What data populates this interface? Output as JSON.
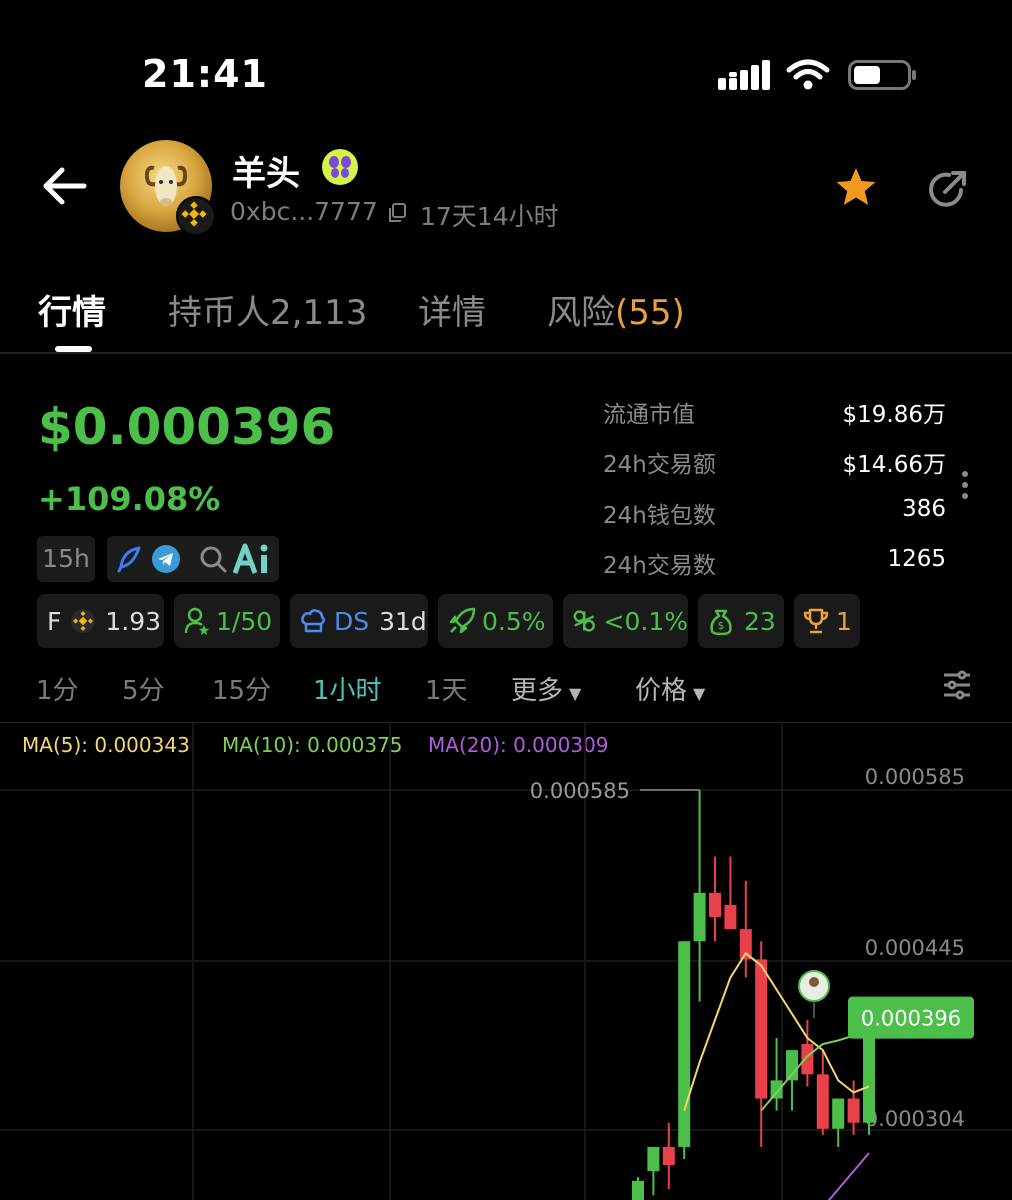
{
  "status_bar": {
    "time": "21:41"
  },
  "header": {
    "token_name": "羊头",
    "address": "0xbc...7777",
    "age": "17天14小时",
    "icons": [
      "back-arrow-icon",
      "ram-avatar-icon",
      "bnb-chain-icon",
      "verified-butterfly-icon",
      "copy-icon",
      "star-icon",
      "share-icon"
    ]
  },
  "tabs": [
    {
      "label": "行情"
    },
    {
      "label": "持币人2,113"
    },
    {
      "label": "详情"
    },
    {
      "label": "风险",
      "count": "(55)"
    }
  ],
  "price": {
    "value": "$0.000396",
    "change": "+109.08%",
    "age_pill": "15h"
  },
  "stats": [
    {
      "label": "流通市值",
      "value": "$19.86万"
    },
    {
      "label": "24h交易额",
      "value": "$14.66万"
    },
    {
      "label": "24h钱包数",
      "value": "386"
    },
    {
      "label": "24h交易数",
      "value": "1265"
    }
  ],
  "badges": {
    "f_label": "F",
    "f_value": "1.93",
    "holders": "1/50",
    "ds_label": "DS",
    "ds_value": "31d",
    "rocket": "0.5%",
    "bundle": "<0.1%",
    "money": "23",
    "trophy": "1"
  },
  "intervals": [
    {
      "label": "1分"
    },
    {
      "label": "5分"
    },
    {
      "label": "15分"
    },
    {
      "label": "1小时",
      "active": true
    },
    {
      "label": "1天"
    },
    {
      "label": "更多"
    },
    {
      "label": "价格"
    }
  ],
  "ma": {
    "ma5": "MA(5): 0.000343",
    "ma10": "MA(10): 0.000375",
    "ma20": "MA(20): 0.000309"
  },
  "chart_data": {
    "type": "candlestick",
    "y_ticks": [
      "0.000585",
      "0.000445",
      "0.000304"
    ],
    "high_label": "0.000585",
    "current_price_label": "0.000396",
    "ylim": [
      0.00024,
      0.00062
    ],
    "candles": [
      {
        "o": 0.000245,
        "h": 0.000265,
        "l": 0.00023,
        "c": 0.000262
      },
      {
        "o": 0.00027,
        "h": 0.00029,
        "l": 0.00025,
        "c": 0.00029
      },
      {
        "o": 0.00029,
        "h": 0.00031,
        "l": 0.000255,
        "c": 0.000275
      },
      {
        "o": 0.00029,
        "h": 0.00046,
        "l": 0.00028,
        "c": 0.00046
      },
      {
        "o": 0.00046,
        "h": 0.000585,
        "l": 0.00041,
        "c": 0.0005
      },
      {
        "o": 0.0005,
        "h": 0.00053,
        "l": 0.00046,
        "c": 0.00048
      },
      {
        "o": 0.00049,
        "h": 0.00053,
        "l": 0.00047,
        "c": 0.00047
      },
      {
        "o": 0.00047,
        "h": 0.00051,
        "l": 0.00043,
        "c": 0.000445
      },
      {
        "o": 0.000445,
        "h": 0.00046,
        "l": 0.00029,
        "c": 0.00033
      },
      {
        "o": 0.00033,
        "h": 0.00038,
        "l": 0.00032,
        "c": 0.000345
      },
      {
        "o": 0.000345,
        "h": 0.00037,
        "l": 0.00032,
        "c": 0.00037
      },
      {
        "o": 0.000375,
        "h": 0.000395,
        "l": 0.00034,
        "c": 0.00035
      },
      {
        "o": 0.00035,
        "h": 0.00037,
        "l": 0.0003,
        "c": 0.000305
      },
      {
        "o": 0.000305,
        "h": 0.00033,
        "l": 0.00029,
        "c": 0.00033
      },
      {
        "o": 0.00033,
        "h": 0.000345,
        "l": 0.0003,
        "c": 0.00031
      },
      {
        "o": 0.00031,
        "h": 0.00041,
        "l": 0.0003,
        "c": 0.000396
      }
    ],
    "ma5": [
      null,
      null,
      null,
      0.00032,
      0.00036,
      0.000395,
      0.00043,
      0.00045,
      0.00044,
      0.00042,
      0.0004,
      0.00038,
      0.00037,
      0.000345,
      0.000335,
      0.00034
    ],
    "ma10": [
      null,
      null,
      null,
      null,
      null,
      null,
      null,
      null,
      0.00032,
      0.000335,
      0.00035,
      0.000365,
      0.000375,
      0.000378,
      0.000382,
      0.000385
    ],
    "ma20": [
      null,
      null,
      null,
      null,
      null,
      null,
      null,
      null,
      null,
      null,
      null,
      null,
      0.00024,
      0.000255,
      0.00027,
      0.000285
    ]
  },
  "colors": {
    "up": "#4cbf4a",
    "down": "#e9414c",
    "ma5": "#f5d76e",
    "ma10": "#7fcf5a",
    "ma20": "#b15be0",
    "accent": "#49c4b8",
    "risk": "#e9a23b"
  }
}
